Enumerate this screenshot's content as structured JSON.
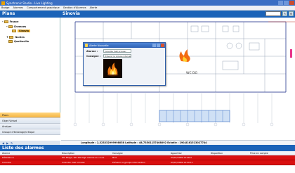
{
  "window": {
    "title": "Synchronic Studio - Live Lighting"
  },
  "menu": [
    "Badge",
    "Alarmes",
    "Comportement graphique",
    "Gestion d'Alarmes",
    "Alerte"
  ],
  "header": {
    "plans_label": "Plans",
    "site_name": "Sinovia"
  },
  "tree": [
    {
      "label": "France",
      "level": 0,
      "expander": "-"
    },
    {
      "label": "Chemnes",
      "level": 1,
      "expander": "-"
    },
    {
      "label": "Sinovia",
      "level": 2,
      "expander": "",
      "selected": true
    },
    {
      "label": "Nantes",
      "level": 1,
      "expander": "+"
    },
    {
      "label": "Quetteville",
      "level": 1,
      "expander": ""
    }
  ],
  "left_buttons": [
    {
      "label": "Plans",
      "active": true
    },
    {
      "label": "Objet Virtuel",
      "active": false
    },
    {
      "label": "Analyse",
      "active": false
    },
    {
      "label": "Groupe d'éclairage/critique",
      "active": false
    }
  ],
  "dialog": {
    "title": "Alerte Nouvelle",
    "alarm_label": "Alarme :",
    "alarm_value": "Incendie mail urinaisc",
    "consigne_label": "Consigne :",
    "consigne_value": "Prévenir le groupe intervention",
    "photo_icon": "fire-photo"
  },
  "map": {
    "fire_label": "WC DG"
  },
  "status": {
    "coords": "Longitude : 2,323232999998058 Latitude : 48,73501157408092 Echelle : 190,8161513027744"
  },
  "alarms": {
    "title": "Liste des alarmes",
    "columns": [
      "Alarme",
      "Description",
      "Consigne",
      "Apparition",
      "Disparition",
      "Prise en compte"
    ],
    "rows": [
      [
        "Défaillance",
        "WC Etage, WC DG High alarme en cours",
        "Nuit",
        "03/07/2009 13:48:4",
        "",
        ""
      ],
      [
        "Incendie",
        "Incendie mail urinaisc",
        "Prévenir le groupe intervention",
        "03/07/2009 14:20:11",
        "",
        ""
      ]
    ]
  },
  "colors": {
    "accent": "#1b63b8",
    "alarm_row": "#d90f0f",
    "selection": "#f2b73d"
  }
}
